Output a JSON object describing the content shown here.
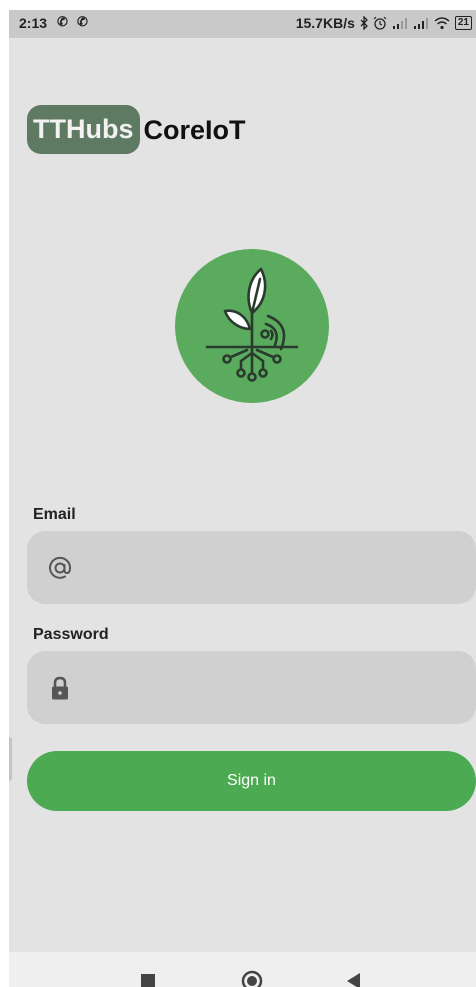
{
  "status_bar": {
    "time": "2:13",
    "call_icons": [
      "phone-icon",
      "phone-icon"
    ],
    "net_speed": "15.7KB/s",
    "battery": "21",
    "icons": [
      "bluetooth-icon",
      "alarm-icon",
      "signal-icon",
      "signal-icon",
      "wifi-icon",
      "battery-icon"
    ]
  },
  "brand": {
    "badge": "TTHubs",
    "name": "CoreIoT"
  },
  "logo": {
    "icon": "plant-iot-icon",
    "background": "#5bab5e"
  },
  "form": {
    "email_label": "Email",
    "email_icon": "at-icon",
    "email_value": "",
    "password_label": "Password",
    "password_icon": "lock-icon",
    "password_value": "",
    "submit_label": "Sign in"
  },
  "nav": {
    "buttons": [
      "recent-apps-icon",
      "home-icon",
      "back-icon"
    ]
  },
  "colors": {
    "brand_badge": "#5e7a62",
    "accent": "#4caa52",
    "background": "#e3e3e3",
    "input_bg": "#d0d0d0"
  }
}
